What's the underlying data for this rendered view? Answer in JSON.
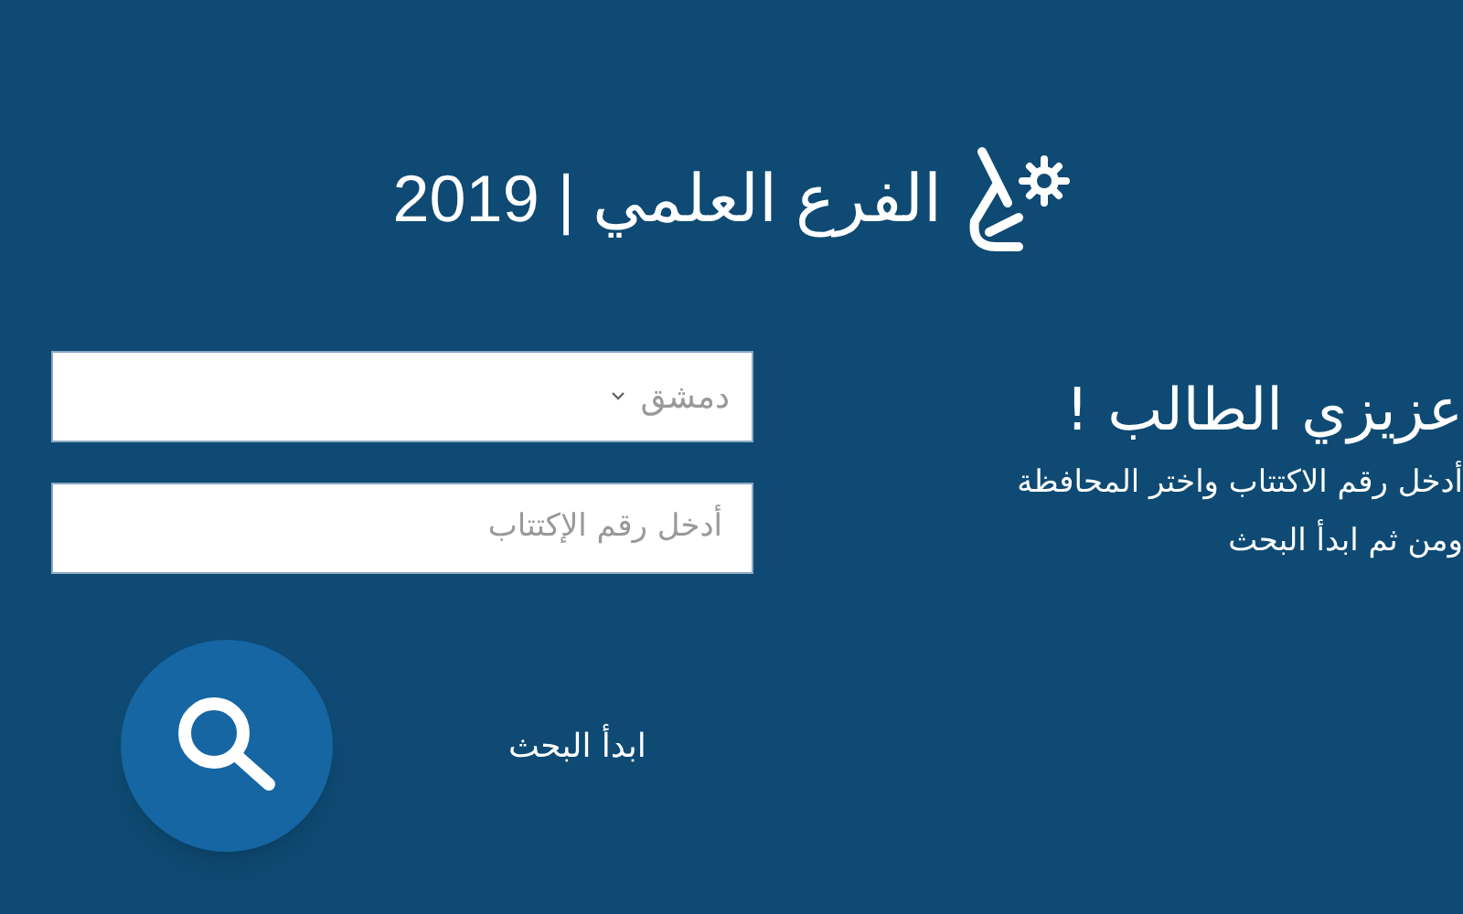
{
  "header": {
    "title": "الفرع العلمي | 2019"
  },
  "form": {
    "governorate": {
      "value": "دمشق"
    },
    "exam_number": {
      "placeholder": "أدخل رقم الإكتتاب"
    },
    "search_button_label": "ابدأ البحث"
  },
  "intro": {
    "heading": "عزيزي الطالب !",
    "lines": [
      "أدخل رقم الاكتتاب واختر المحافظة",
      "ومن ثم ابدأ البحث"
    ]
  }
}
